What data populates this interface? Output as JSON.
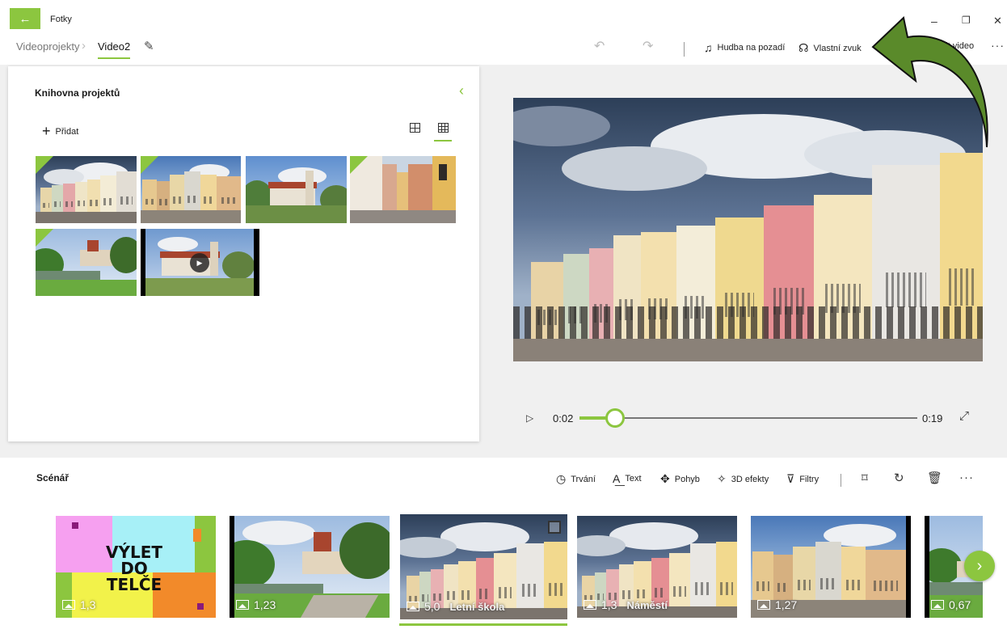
{
  "app": {
    "title": "Fotky",
    "back_icon": "arrow-left-icon",
    "accent": "#8cc63f"
  },
  "window": {
    "minimize": "–",
    "maximize": "❐",
    "close": "✕"
  },
  "breadcrumb": {
    "root": "Videoprojekty",
    "current": "Video2"
  },
  "toolbar": {
    "background_music": "Hudba na pozadí",
    "custom_audio": "Vlastní zvuk",
    "finish_video": "Dokončit video",
    "more": "···"
  },
  "library": {
    "title": "Knihovna projektů",
    "add_label": "Přidat",
    "items": [
      {
        "kind": "photo",
        "scene": "square-dark-sky",
        "in_use": true
      },
      {
        "kind": "photo",
        "scene": "square-blue-sky",
        "in_use": true
      },
      {
        "kind": "photo",
        "scene": "castle",
        "in_use": false
      },
      {
        "kind": "photo",
        "scene": "alley",
        "in_use": true
      },
      {
        "kind": "photo",
        "scene": "park-castle",
        "in_use": true
      },
      {
        "kind": "video",
        "scene": "castle-video",
        "in_use": false
      }
    ]
  },
  "preview": {
    "current_time": "0:02",
    "end_time": "0:19",
    "progress": 0.105
  },
  "storyboard": {
    "title": "Scénář",
    "tools": {
      "duration": "Trvání",
      "text": "Text",
      "motion": "Pohyb",
      "effects_3d": "3D efekty",
      "filters": "Filtry"
    },
    "more": "···",
    "title_card_text": [
      "VÝLET",
      "DO",
      "TELČE"
    ],
    "cards": [
      {
        "duration": "1,3",
        "caption": "",
        "type": "title-card"
      },
      {
        "duration": "1,23",
        "caption": "",
        "type": "photo"
      },
      {
        "duration": "5,0",
        "caption": "Letní škola",
        "type": "photo",
        "selected": true
      },
      {
        "duration": "1,3",
        "caption": "Náměstí",
        "type": "photo"
      },
      {
        "duration": "1,27",
        "caption": "",
        "type": "photo"
      },
      {
        "duration": "0,67",
        "caption": "",
        "type": "photo"
      }
    ]
  },
  "annotation": {
    "shape": "curved-arrow",
    "color": "#5a8a2a"
  }
}
